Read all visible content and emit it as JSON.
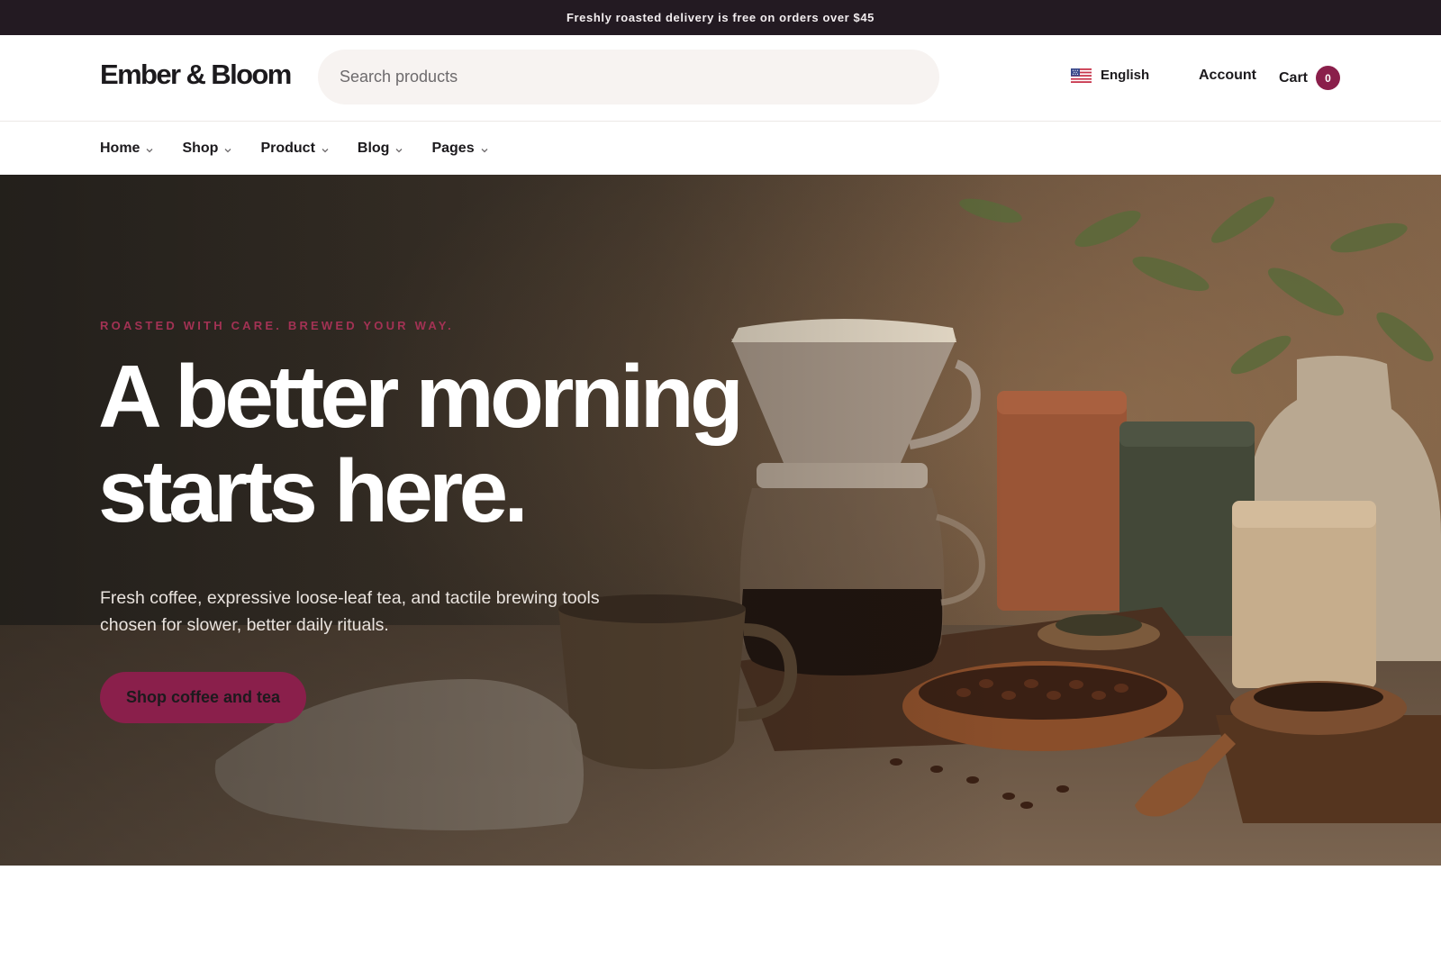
{
  "announcement": {
    "text": "Freshly roasted delivery is free on orders over $45"
  },
  "header": {
    "logo": "Ember & Bloom",
    "search_placeholder": "Search products",
    "language": {
      "label": "English",
      "flag_icon": "us-flag-icon"
    },
    "account_label": "Account",
    "cart": {
      "label": "Cart",
      "count": "0"
    }
  },
  "nav": {
    "items": [
      {
        "label": "Home"
      },
      {
        "label": "Shop"
      },
      {
        "label": "Product"
      },
      {
        "label": "Blog"
      },
      {
        "label": "Pages"
      }
    ]
  },
  "hero": {
    "eyebrow": "ROASTED WITH CARE. BREWED YOUR WAY.",
    "headline_line1": "A better morning",
    "headline_line2": "starts here.",
    "subtext": "Fresh coffee, expressive loose-leaf tea, and tactile brewing tools chosen for slower, better daily rituals.",
    "cta_label": "Shop coffee and tea"
  },
  "colors": {
    "announcement_bg": "#231a22",
    "accent": "#8a1f4b",
    "eyebrow": "#a33254",
    "text_dark": "#1c1a1d",
    "search_bg": "#f7f3f1"
  }
}
